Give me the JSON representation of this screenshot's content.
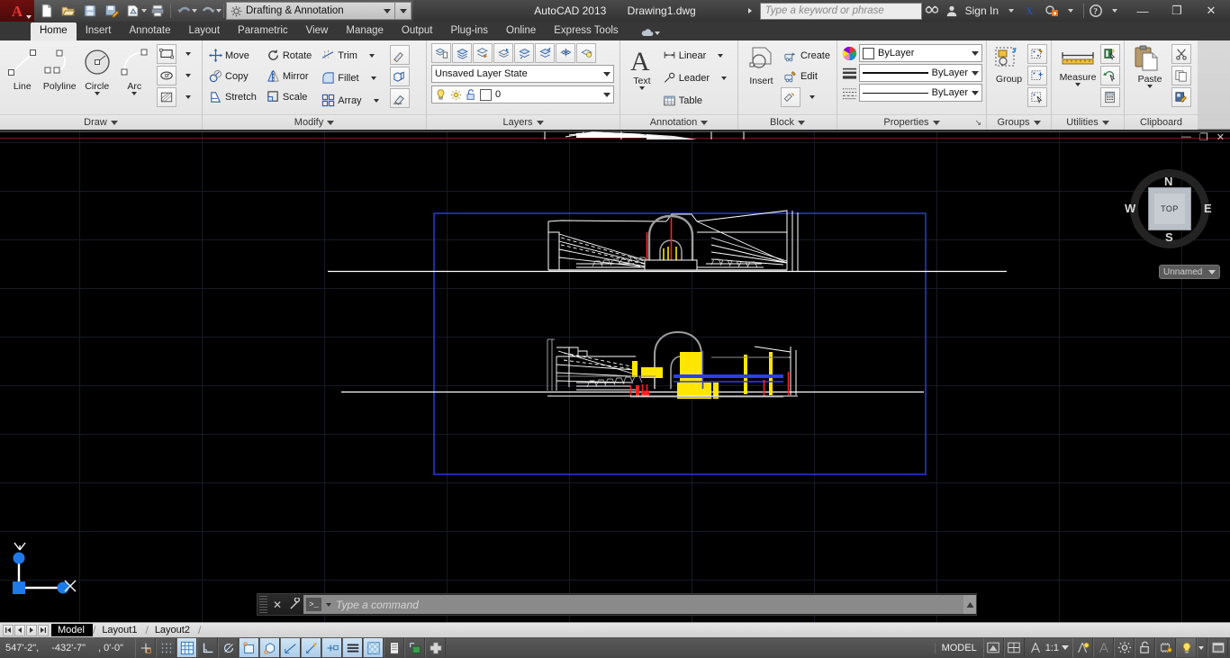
{
  "titlebar": {
    "app_name": "AutoCAD 2013",
    "document": "Drawing1.dwg",
    "workspace": "Drafting & Annotation",
    "search_placeholder": "Type a keyword or phrase",
    "signin": "Sign In",
    "quick_access": [
      {
        "name": "new-icon",
        "tip": "New"
      },
      {
        "name": "open-icon",
        "tip": "Open"
      },
      {
        "name": "save-icon",
        "tip": "Save"
      },
      {
        "name": "saveas-icon",
        "tip": "Save As"
      },
      {
        "name": "plot-preview-icon",
        "tip": "Plot Preview"
      },
      {
        "name": "plot-icon",
        "tip": "Plot"
      },
      {
        "name": "undo-icon",
        "tip": "Undo"
      },
      {
        "name": "redo-icon",
        "tip": "Redo"
      }
    ],
    "window_controls": {
      "minimize": "—",
      "restore": "❐",
      "close": "✕"
    }
  },
  "ribbon": {
    "tabs": [
      {
        "label": "Home",
        "active": true
      },
      {
        "label": "Insert",
        "active": false
      },
      {
        "label": "Annotate",
        "active": false
      },
      {
        "label": "Layout",
        "active": false
      },
      {
        "label": "Parametric",
        "active": false
      },
      {
        "label": "View",
        "active": false
      },
      {
        "label": "Manage",
        "active": false
      },
      {
        "label": "Output",
        "active": false
      },
      {
        "label": "Plug-ins",
        "active": false
      },
      {
        "label": "Online",
        "active": false
      },
      {
        "label": "Express Tools",
        "active": false
      }
    ],
    "panels": {
      "draw": {
        "title": "Draw",
        "big": [
          {
            "label": "Line",
            "icon": "line-icon"
          },
          {
            "label": "Polyline",
            "icon": "polyline-icon"
          },
          {
            "label": "Circle",
            "icon": "circle-icon"
          },
          {
            "label": "Arc",
            "icon": "arc-icon"
          }
        ],
        "small_icons": [
          {
            "name": "rectangle-icon"
          },
          {
            "name": "ellipse-icon"
          },
          {
            "name": "hatch-icon"
          }
        ]
      },
      "modify": {
        "title": "Modify",
        "rows": [
          [
            {
              "label": "Move",
              "icon": "move-icon"
            },
            {
              "label": "Rotate",
              "icon": "rotate-icon"
            },
            {
              "label": "Trim",
              "icon": "trim-icon",
              "split": true
            }
          ],
          [
            {
              "label": "Copy",
              "icon": "copy-icon"
            },
            {
              "label": "Mirror",
              "icon": "mirror-icon"
            },
            {
              "label": "Fillet",
              "icon": "fillet-icon",
              "split": true
            }
          ],
          [
            {
              "label": "Stretch",
              "icon": "stretch-icon"
            },
            {
              "label": "Scale",
              "icon": "scale-icon"
            },
            {
              "label": "Array",
              "icon": "array-icon",
              "split": true
            }
          ]
        ],
        "side_icons": [
          {
            "name": "match-properties-icon"
          },
          {
            "name": "explode-3d-icon"
          },
          {
            "name": "erase-icon"
          }
        ]
      },
      "layers": {
        "title": "Layers",
        "top_icons": [
          {
            "name": "layer-properties-icon"
          },
          {
            "name": "layer-make-current-icon"
          },
          {
            "name": "layer-match-icon"
          },
          {
            "name": "layer-previous-icon"
          },
          {
            "name": "layer-off-icon"
          },
          {
            "name": "layer-isolate-icon"
          },
          {
            "name": "layer-freeze-icon"
          },
          {
            "name": "layer-on-icon"
          }
        ],
        "layer_state": "Unsaved Layer State",
        "current_layer": "0",
        "layer_toggles": [
          {
            "name": "lightbulb-icon"
          },
          {
            "name": "sun-icon"
          },
          {
            "name": "unlock-icon"
          },
          {
            "name": "layer-color-swatch"
          }
        ]
      },
      "annotation": {
        "title": "Annotation",
        "big": {
          "label": "Text",
          "icon": "text-icon"
        },
        "items": [
          {
            "label": "Linear",
            "icon": "linear-dimension-icon",
            "split": true
          },
          {
            "label": "Leader",
            "icon": "leader-icon",
            "split": true
          },
          {
            "label": "Table",
            "icon": "table-icon",
            "split": false
          }
        ]
      },
      "block": {
        "title": "Block",
        "big": {
          "label": "Insert",
          "icon": "insert-block-icon"
        },
        "items": [
          {
            "label": "Create",
            "icon": "create-block-icon"
          },
          {
            "label": "Edit",
            "icon": "edit-block-icon"
          }
        ],
        "extra_icon": {
          "name": "block-attribute-icon"
        }
      },
      "properties": {
        "title": "Properties",
        "color": "ByLayer",
        "linetype": "ByLayer",
        "lineweight": "ByLayer",
        "color_swatch": "#ffffff"
      },
      "groups": {
        "title": "Groups",
        "big": {
          "label": "Group",
          "icon": "group-icon"
        },
        "icons": [
          {
            "name": "group-edit-icon"
          },
          {
            "name": "group-add-icon"
          },
          {
            "name": "group-selection-icon"
          }
        ]
      },
      "utilities": {
        "title": "Utilities",
        "big": {
          "label": "Measure",
          "icon": "measure-icon"
        },
        "icons": [
          {
            "name": "quick-select-icon"
          },
          {
            "name": "quick-calc-cursor-icon"
          },
          {
            "name": "calculator-icon"
          }
        ]
      },
      "clipboard": {
        "title": "Clipboard",
        "big": {
          "label": "Paste",
          "icon": "paste-icon"
        },
        "icons": [
          {
            "name": "cut-icon"
          },
          {
            "name": "copy-clip-icon"
          },
          {
            "name": "paste-special-icon"
          }
        ]
      }
    }
  },
  "drawing": {
    "viewcube": {
      "top": "TOP",
      "n": "N",
      "e": "E",
      "s": "S",
      "w": "W"
    },
    "view_name": "Unnamed",
    "ucs": {
      "x": "X",
      "y": "Y"
    },
    "command_placeholder": "Type a command",
    "command_prompt_glyph": ">_"
  },
  "layout_tabs": {
    "tabs": [
      {
        "label": "Model",
        "active": true
      },
      {
        "label": "Layout1",
        "active": false
      },
      {
        "label": "Layout2",
        "active": false
      }
    ],
    "nav": [
      "first-layout",
      "prev-layout",
      "next-layout",
      "last-layout"
    ]
  },
  "status": {
    "coordinates": [
      "547'-2\",",
      "-432'-7\"",
      ", 0'-0\""
    ],
    "left_toggles": [
      {
        "name": "infer-constraints-icon",
        "on": false
      },
      {
        "name": "snap-mode-icon",
        "on": false
      },
      {
        "name": "grid-display-icon",
        "on": true
      },
      {
        "name": "ortho-mode-icon",
        "on": false
      },
      {
        "name": "polar-tracking-icon",
        "on": false
      },
      {
        "name": "object-snap-icon",
        "on": true
      },
      {
        "name": "3d-object-snap-icon",
        "on": true
      },
      {
        "name": "object-snap-tracking-icon",
        "on": true
      },
      {
        "name": "dynamic-ucs-icon",
        "on": true
      },
      {
        "name": "dynamic-input-icon",
        "on": true
      },
      {
        "name": "lineweight-icon",
        "on": true
      },
      {
        "name": "transparency-icon",
        "on": false
      },
      {
        "name": "quick-properties-icon",
        "on": false
      },
      {
        "name": "selection-cycling-icon",
        "on": false
      },
      {
        "name": "annotation-monitor-icon",
        "on": false
      }
    ],
    "model_label": "MODEL",
    "annotation_scale": "1:1",
    "right_icons": [
      {
        "name": "layout-viewport-icon"
      },
      {
        "name": "model-layout-icon"
      },
      {
        "name": "annotation-visibility-icon"
      },
      {
        "name": "auto-scale-icon"
      },
      {
        "name": "workspace-switch-icon"
      },
      {
        "name": "toolbar-lock-icon"
      },
      {
        "name": "hardware-acceleration-icon"
      },
      {
        "name": "isolate-objects-icon"
      },
      {
        "name": "clean-screen-icon"
      }
    ]
  }
}
